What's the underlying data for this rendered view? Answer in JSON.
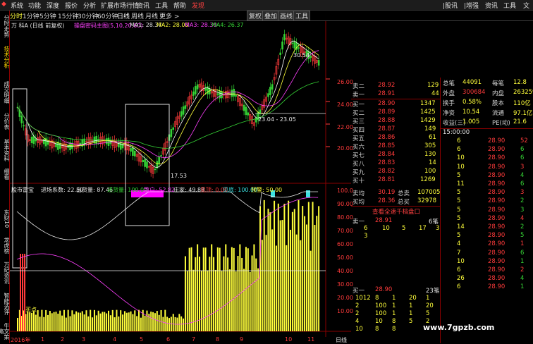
{
  "menu": [
    "系统",
    "功能",
    "深度",
    "报价",
    "分析",
    "扩展市场行情",
    "资讯",
    "工具",
    "帮助",
    "发现"
  ],
  "menu_right": [
    "|股讯",
    "|增强",
    "资讯",
    "工具",
    "文"
  ],
  "toolbar": [
    "分时",
    "1分钟",
    "5分钟",
    "15分钟",
    "30分钟",
    "60分钟",
    "日线",
    "周线",
    "月线",
    "更多 >"
  ],
  "toolbar_right": [
    "复权",
    "叠加",
    "画线",
    "工具"
  ],
  "sidebar": [
    "分时走势",
    "技术分析",
    "成交明细",
    "分价表",
    "基本资料",
    "细看",
    "东财10",
    "龙虎榜",
    "万纪资讯",
    "智能选评",
    "牛文策略"
  ],
  "chart_header": {
    "stock": "万 科A (日线 前复权)",
    "indicator": "操盘密码主图(5,10,20,60)",
    "ma1": "MA1: 28.37",
    "ma2": "MA2: 28.00",
    "ma3": "MA3: 28.30",
    "ma4": "MA4: 26.37"
  },
  "price_axis": [
    "26.00",
    "24.00",
    "22.00",
    "20.00"
  ],
  "price_labels": {
    "high": "30.54",
    "low": "17.53",
    "range": "23.04 - 23.05"
  },
  "sub_header": {
    "name": "股市雷宝",
    "a": "进场系数: 22.50",
    "b": "出货量: 87.46",
    "c": "进货量: 100.00",
    "d": "散户: 52.82",
    "e": "庄家: 49.88",
    "f": "见顶: 0.00",
    "g": "见底: 100.00",
    "h": "预警: 50.00"
  },
  "sub_axis": [
    "100.0",
    "90.00",
    "80.00",
    "70.00",
    "60.00",
    "50.00",
    "40.00",
    "30.00",
    "20.00",
    "10.00"
  ],
  "x_axis": [
    "2016年",
    "1",
    "2",
    "3",
    "4",
    "5",
    "6",
    "7",
    "8",
    "9",
    "10",
    "11"
  ],
  "x_axis_right": "日线",
  "small_label": "买点",
  "asks": [
    {
      "label": "卖二",
      "price": "28.92",
      "vol": "129"
    },
    {
      "label": "卖一",
      "price": "28.91",
      "vol": "44"
    }
  ],
  "bids": [
    {
      "label": "买一",
      "price": "28.90",
      "vol": "1347"
    },
    {
      "label": "买二",
      "price": "28.89",
      "vol": "1425"
    },
    {
      "label": "买三",
      "price": "28.88",
      "vol": "1429"
    },
    {
      "label": "买四",
      "price": "28.87",
      "vol": "149"
    },
    {
      "label": "买五",
      "price": "28.86",
      "vol": "61"
    },
    {
      "label": "买六",
      "price": "28.85",
      "vol": "305"
    },
    {
      "label": "买七",
      "price": "28.84",
      "vol": "130"
    },
    {
      "label": "买八",
      "price": "28.83",
      "vol": "14"
    },
    {
      "label": "买九",
      "price": "28.82",
      "vol": "100"
    },
    {
      "label": "买十",
      "price": "28.81",
      "vol": "1269"
    }
  ],
  "avg": [
    {
      "label": "卖均",
      "price": "30.19",
      "k": "总卖",
      "v": "107005"
    },
    {
      "label": "买均",
      "price": "28.36",
      "k": "总买",
      "v": "32978"
    }
  ],
  "detail_link": "查看全速千档盘口",
  "stats": [
    {
      "k": "总笔",
      "v": "44091",
      "k2": "每笔",
      "v2": "12.8"
    },
    {
      "k": "外盘",
      "v": "300684",
      "k2": "内盘",
      "v2": "263259"
    },
    {
      "k": "换手",
      "v": "0.58%",
      "k2": "股本",
      "v2": "110亿"
    },
    {
      "k": "净资",
      "v": "10.54",
      "k2": "流通",
      "v2": "97.1亿"
    },
    {
      "k": "收益(三)",
      "v": "1.005",
      "k2": "PE(动)",
      "v2": "21.6"
    }
  ],
  "ticks_time": "15:00:00",
  "ticks": [
    {
      "n": "6",
      "p": "28.90",
      "v": "52"
    },
    {
      "n": "6",
      "p": "28.90",
      "v": "6"
    },
    {
      "n": "10",
      "p": "28.90",
      "v": "6"
    },
    {
      "n": "10",
      "p": "28.90",
      "v": "3"
    },
    {
      "n": "5",
      "p": "28.90",
      "v": "4"
    },
    {
      "n": "11",
      "p": "28.90",
      "v": "6"
    },
    {
      "n": "5",
      "p": "28.90",
      "v": "3"
    },
    {
      "n": "5",
      "p": "28.90",
      "v": "2"
    },
    {
      "n": "5",
      "p": "28.90",
      "v": "3"
    },
    {
      "n": "5",
      "p": "28.90",
      "v": "4"
    },
    {
      "n": "14",
      "p": "28.90",
      "v": "2"
    },
    {
      "n": "5",
      "p": "28.90",
      "v": "5"
    },
    {
      "n": "4",
      "p": "28.90",
      "v": "1"
    },
    {
      "n": "7",
      "p": "28.90",
      "v": "6"
    },
    {
      "n": "10",
      "p": "28.90",
      "v": "1"
    },
    {
      "n": "6",
      "p": "28.90",
      "v": "2"
    },
    {
      "n": "26",
      "p": "28.90",
      "v": "4"
    },
    {
      "n": "6",
      "p": "28.90",
      "v": "1"
    }
  ],
  "queue_sell": {
    "label": "卖一",
    "price": "28.91",
    "count": "6笔",
    "nums": [
      "6",
      "10",
      "5",
      "17",
      "3"
    ],
    "nums2": [
      "3"
    ]
  },
  "queue_buy": {
    "label": "买一",
    "price": "28.90",
    "count": "23笔",
    "rows": [
      [
        "1012",
        "8",
        "1",
        "20",
        "1"
      ],
      [
        "2",
        "100",
        "1",
        "1",
        "20"
      ],
      [
        "2",
        "100",
        "1",
        "1",
        "5"
      ],
      [
        "4",
        "10",
        "8",
        "5",
        "2"
      ],
      [
        "10",
        "8",
        "8",
        ""
      ]
    ]
  },
  "watermark": "www.7gpzb.com",
  "colors": {
    "bg": "#000000",
    "up": "#ff3b3b",
    "down": "#35d335",
    "volume": "#ffff3b",
    "accent": "#ff00ff"
  }
}
